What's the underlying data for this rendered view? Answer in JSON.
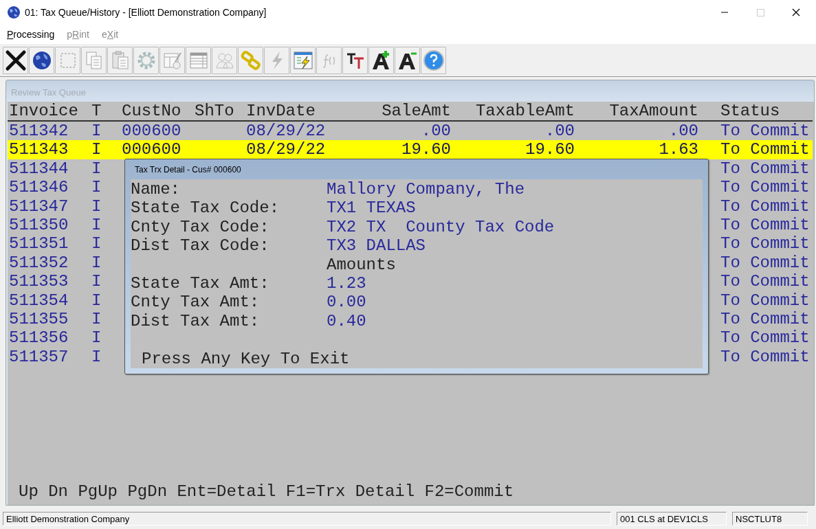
{
  "window": {
    "title": "01: Tax Queue/History - [Elliott Demonstration Company]"
  },
  "menu": [
    {
      "key": "P",
      "after": "rocessing",
      "disabled": false
    },
    {
      "before": "p",
      "key": "R",
      "after": "int",
      "disabled": true
    },
    {
      "before": "e",
      "key": "X",
      "after": "it",
      "disabled": true
    }
  ],
  "toolbar": [
    {
      "kind": "close",
      "disabled": false
    },
    {
      "kind": "globe",
      "disabled": false
    },
    {
      "kind": "select",
      "disabled": true
    },
    {
      "kind": "copy",
      "disabled": true
    },
    {
      "kind": "paste",
      "disabled": true
    },
    {
      "kind": "gear",
      "disabled": true
    },
    {
      "kind": "form",
      "disabled": true
    },
    {
      "kind": "table",
      "disabled": true
    },
    {
      "kind": "people",
      "disabled": true
    },
    {
      "kind": "link",
      "disabled": false
    },
    {
      "kind": "bolt",
      "disabled": true
    },
    {
      "kind": "window-bolt",
      "disabled": false
    },
    {
      "kind": "function",
      "disabled": true
    },
    {
      "kind": "font",
      "disabled": false
    },
    {
      "kind": "grow",
      "disabled": false
    },
    {
      "kind": "shrink",
      "disabled": false
    },
    {
      "kind": "help",
      "disabled": false
    }
  ],
  "panel": {
    "title": "Review Tax Queue"
  },
  "table": {
    "columns": [
      "Invoice",
      "T",
      "CustNo",
      "ShTo",
      "InvDate",
      "SaleAmt",
      "TaxableAmt",
      "TaxAmount",
      "Status"
    ],
    "rows": [
      {
        "selected": false,
        "cells": [
          "511342",
          "I",
          "000600",
          "",
          "08/29/22",
          ".00",
          ".00",
          ".00",
          "To Commit"
        ]
      },
      {
        "selected": true,
        "cells": [
          "511343",
          "I",
          "000600",
          "",
          "08/29/22",
          "19.60",
          "19.60",
          "1.63",
          "To Commit"
        ]
      },
      {
        "selected": false,
        "cells": [
          "511344",
          "I",
          "",
          "",
          "",
          "",
          "",
          "",
          "To Commit"
        ]
      },
      {
        "selected": false,
        "cells": [
          "511346",
          "I",
          "",
          "",
          "",
          "",
          "",
          "",
          "To Commit"
        ]
      },
      {
        "selected": false,
        "cells": [
          "511347",
          "I",
          "",
          "",
          "",
          "",
          "",
          "",
          "To Commit"
        ]
      },
      {
        "selected": false,
        "cells": [
          "511350",
          "I",
          "",
          "",
          "",
          "",
          "",
          "",
          "To Commit"
        ]
      },
      {
        "selected": false,
        "cells": [
          "511351",
          "I",
          "",
          "",
          "",
          "",
          "",
          "",
          "To Commit"
        ]
      },
      {
        "selected": false,
        "cells": [
          "511352",
          "I",
          "",
          "",
          "",
          "",
          "",
          "",
          "To Commit"
        ]
      },
      {
        "selected": false,
        "cells": [
          "511353",
          "I",
          "",
          "",
          "",
          "",
          "",
          "",
          "To Commit"
        ]
      },
      {
        "selected": false,
        "cells": [
          "511354",
          "I",
          "",
          "",
          "",
          "",
          "",
          "",
          "To Commit"
        ]
      },
      {
        "selected": false,
        "cells": [
          "511355",
          "I",
          "",
          "",
          "",
          "",
          "",
          "",
          "To Commit"
        ]
      },
      {
        "selected": false,
        "cells": [
          "511356",
          "I",
          "",
          "",
          "",
          "",
          "",
          "",
          "To Commit"
        ]
      },
      {
        "selected": false,
        "cells": [
          "511357",
          "I",
          "",
          "",
          "",
          "",
          "",
          "",
          "To Commit"
        ]
      }
    ]
  },
  "dialog": {
    "title": "Tax Trx Detail - Cus# 000600",
    "lines": [
      {
        "kind": "field",
        "label": "Name:",
        "value": "Mallory Company, The"
      },
      {
        "kind": "field",
        "label": "State Tax Code:",
        "value": "TX1 TEXAS"
      },
      {
        "kind": "field",
        "label": "Cnty Tax Code:",
        "value": "TX2 TX  County Tax Code"
      },
      {
        "kind": "field",
        "label": "Dist Tax Code:",
        "value": "TX3 DALLAS"
      },
      {
        "kind": "heading",
        "value": "Amounts"
      },
      {
        "kind": "field",
        "label": "State Tax Amt:",
        "value": "1.23"
      },
      {
        "kind": "field",
        "label": "Cnty Tax Amt:",
        "value": "0.00"
      },
      {
        "kind": "field",
        "label": "Dist Tax Amt:",
        "value": "0.40"
      }
    ],
    "footer": "Press Any Key To Exit"
  },
  "key_hints": "Up Dn PgUp PgDn Ent=Detail F1=Trx Detail F2=Commit",
  "status_bar": [
    "Elliott Demonstration Company",
    "001 CLS at DEV1CLS",
    "NSCTLUT8"
  ]
}
